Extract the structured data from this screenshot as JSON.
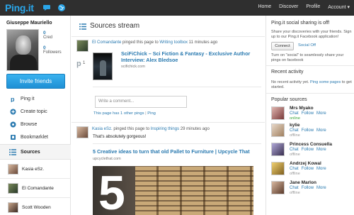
{
  "topbar": {
    "logo": "Ping.it",
    "nav": [
      "Home",
      "Discover",
      "Profile",
      "Account ▾"
    ]
  },
  "profile": {
    "name": "Giuseppe Mauriello",
    "cred_count": "0",
    "cred_label": "Cred",
    "followers_count": "0",
    "followers_label": "Followers",
    "invite_label": "Invite friends"
  },
  "menu": [
    {
      "label": "Ping it",
      "icon": "p-icon"
    },
    {
      "label": "Create topic",
      "icon": "plus-icon"
    },
    {
      "label": "Browse",
      "icon": "browse-icon"
    },
    {
      "label": "Bookmarklet",
      "icon": "bookmark-icon"
    }
  ],
  "sources": {
    "heading": "Sources",
    "items": [
      {
        "name": "Kasia eSz."
      },
      {
        "name": "El Comandante"
      },
      {
        "name": "Scott Wooden"
      }
    ]
  },
  "stream": {
    "title": "Sources stream",
    "post1": {
      "author": "El Comandante",
      "action": "pinged this page to",
      "topic": "Writing toolbox",
      "time": "11 minutes ago",
      "card_title": "SciFiChick – Sci Fiction & Fantasy - Exclusive Author Interview: Alex Bledsoe",
      "card_url": "scifichick.com",
      "ping_count": "1",
      "comment_placeholder": "Write a comment...",
      "other_pings": "This page has 1 other pings",
      "ping_link": "Ping"
    },
    "post2": {
      "author": "Kasia eSz.",
      "action": "pinged this page to",
      "topic": "Inspiring things",
      "time": "29 minutes ago",
      "body": "That's absolutely gorgeous!",
      "card_title": "5 Creative ideas to turn that old Pallet to Furniture | Upcycle That",
      "card_url": "upcyclethat.com",
      "image_number": "5"
    }
  },
  "right": {
    "social_title": "Ping.it social sharing is off!",
    "social_text": "Share your discoveries with your friends. Sign up to our Ping.it Facebook application!",
    "connect_label": "Connect",
    "social_off_link": "Social Off",
    "social_hint": "Turn on \"social\" to seamlessly share your pings on facebook",
    "recent_title": "Recent activity",
    "recent_text_before": "No recent activity yet.",
    "recent_link": "Ping some pages",
    "recent_text_after": "to get started.",
    "popular_title": "Popular sources",
    "popular": [
      {
        "name": "Mrs Myako",
        "status": "online"
      },
      {
        "name": "kylie",
        "status": "offline"
      },
      {
        "name": "Princess Consuella",
        "status": "offline"
      },
      {
        "name": "Andrzej Kowal",
        "status": "offline"
      },
      {
        "name": "Jane Marlon",
        "status": "offline"
      }
    ],
    "popular_actions": [
      "Chat",
      "Follow",
      "More"
    ]
  },
  "colors": {
    "accent": "#2aa5e8",
    "link": "#2a7ab0",
    "online": "#3aa63a",
    "offline": "#999999",
    "topbar": "#2f2f2f"
  }
}
